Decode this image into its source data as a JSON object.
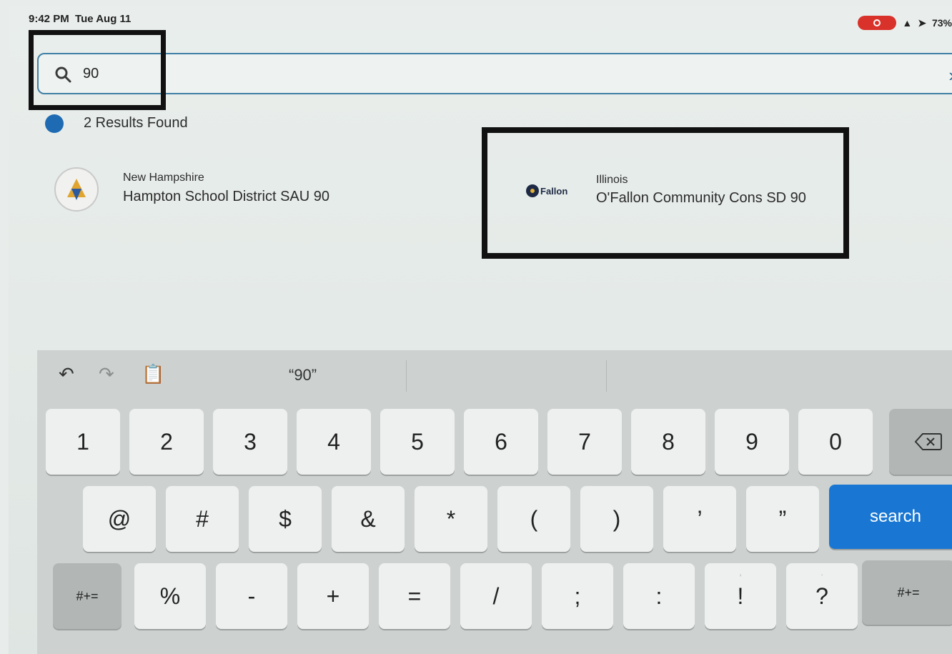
{
  "status_bar": {
    "time": "9:42 PM",
    "date": "Tue Aug 11",
    "battery": "73%"
  },
  "search": {
    "value": "90"
  },
  "results": {
    "count_label": "2 Results Found",
    "items": [
      {
        "state": "New Hampshire",
        "name": "Hampton School District SAU 90",
        "logo": "seal-icon"
      },
      {
        "state": "Illinois",
        "name": "O'Fallon Community Cons SD 90",
        "logo": "ofallon-logo",
        "logo_text": "Fallon"
      }
    ]
  },
  "keyboard": {
    "suggestion": "“90”",
    "row1": [
      "1",
      "2",
      "3",
      "4",
      "5",
      "6",
      "7",
      "8",
      "9",
      "0"
    ],
    "row2": [
      "@",
      "#",
      "$",
      "&",
      "*",
      "(",
      ")",
      "’",
      "”"
    ],
    "row3": [
      "%",
      "-",
      "+",
      "=",
      "/",
      ";",
      ":",
      "!",
      "?"
    ],
    "row3_hints": [
      "",
      "",
      "",
      "",
      "",
      "",
      "",
      ",",
      "."
    ],
    "search_label": "search",
    "symbols_label": "#+="
  },
  "colors": {
    "search_key": "#1977d3",
    "focus_border": "#3f7fa5",
    "results_dot": "#1f6bb3",
    "rec_pill": "#d9322a"
  }
}
